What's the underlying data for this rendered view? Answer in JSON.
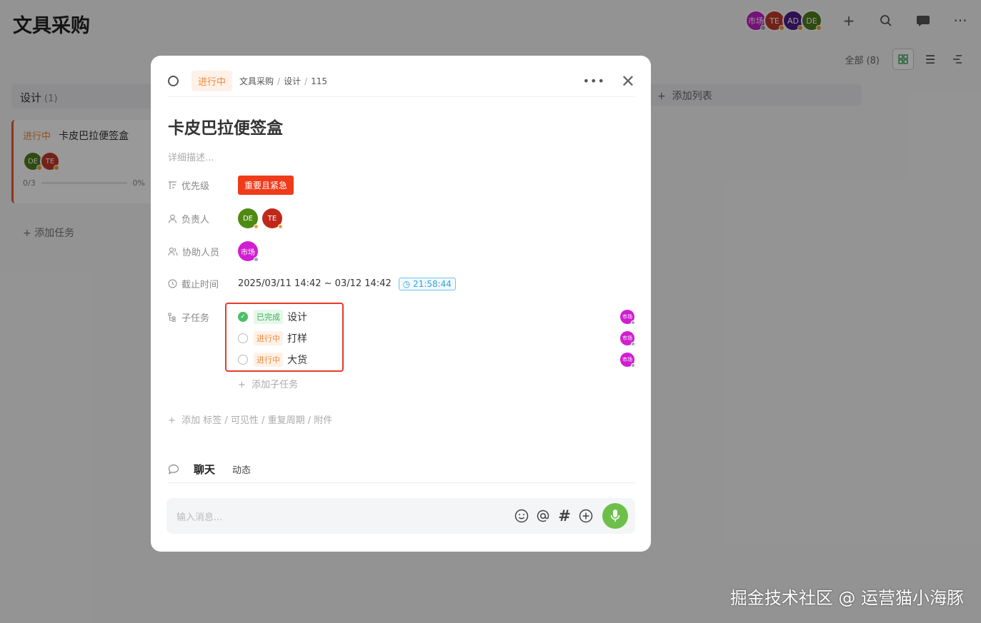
{
  "background": {
    "page_title": "文具采购",
    "header_avatars": [
      {
        "label": "市场",
        "color": "#c31ec9",
        "dot": "#9aa"
      },
      {
        "label": "TE",
        "color": "#c0392b",
        "dot": "#f0a030"
      },
      {
        "label": "AD",
        "color": "#4b1f8a",
        "dot": "#f0a030"
      },
      {
        "label": "DE",
        "color": "#4e7d1f",
        "dot": "#f0a030"
      }
    ],
    "filter_label": "全部 (8)",
    "column": {
      "title": "设计",
      "count": "(1)"
    },
    "task_card": {
      "status": "进行中",
      "title": "卡皮巴拉便签盒",
      "progress": "0/3",
      "percent": "0%"
    },
    "add_task": "添加任务",
    "add_list": "添加列表"
  },
  "modal": {
    "status": "进行中",
    "breadcrumb": [
      "文具采购",
      "设计",
      "115"
    ],
    "title": "卡皮巴拉便签盒",
    "description_placeholder": "详细描述...",
    "priority_label": "优先级",
    "priority_value": "重要且紧急",
    "owner_label": "负责人",
    "owners": [
      {
        "label": "DE",
        "color": "#4e8a14",
        "dot": "#f0a030"
      },
      {
        "label": "TE",
        "color": "#c0281a",
        "dot": "#f0a030"
      }
    ],
    "helper_label": "协助人员",
    "helpers": [
      {
        "label": "市场",
        "color": "#d11ed2",
        "dot": "#9aa"
      }
    ],
    "deadline_label": "截止时间",
    "deadline": "2025/03/11 14:42 ~ 03/12 14:42",
    "timer": "21:58:44",
    "subtask_label": "子任务",
    "subtasks": [
      {
        "status": "已完成",
        "title": "设计",
        "done": true,
        "assignee": "市场"
      },
      {
        "status": "进行中",
        "title": "打样",
        "done": false,
        "assignee": "市场"
      },
      {
        "status": "进行中",
        "title": "大货",
        "done": false,
        "assignee": "市场"
      }
    ],
    "add_subtask": "添加子任务",
    "add_more": "添加 标签 / 可见性 / 重复周期 / 附件",
    "tab_chat": "聊天",
    "tab_activity": "动态",
    "message_placeholder": "输入消息..."
  },
  "watermark": "掘金技术社区 @ 运营猫小海豚"
}
